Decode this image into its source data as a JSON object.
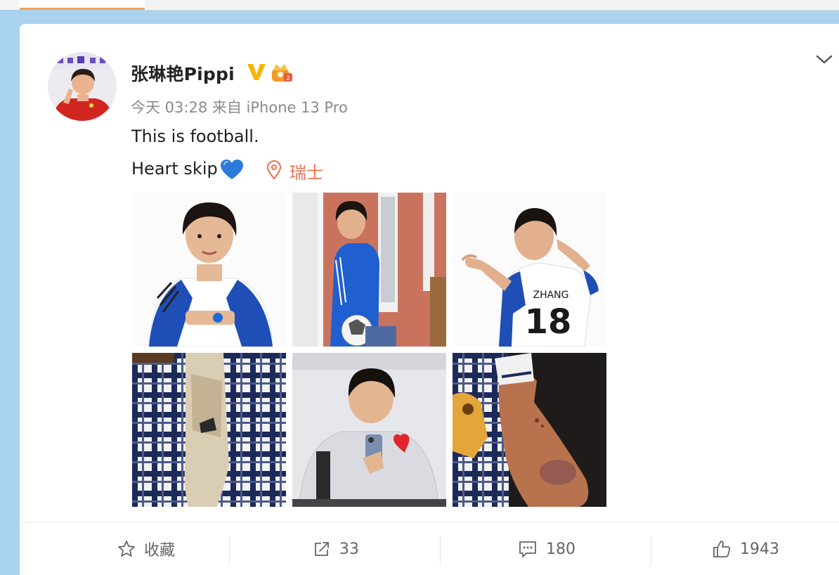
{
  "post": {
    "username": "张琳艳Pippi",
    "meta": "今天 03:28 来自 iPhone 13 Pro",
    "text_line1": "This is football.",
    "text_line2": "Heart skip",
    "location": "瑞士"
  },
  "photos": [
    {
      "icon": "player-front-photo"
    },
    {
      "icon": "player-wall-photo"
    },
    {
      "icon": "player-back-18-photo"
    },
    {
      "icon": "dirty-sock-photo"
    },
    {
      "icon": "mirror-selfie-photo"
    },
    {
      "icon": "bruised-leg-photo"
    }
  ],
  "actions": {
    "favorite_label": "收藏",
    "repost_count": "33",
    "comment_count": "180",
    "like_count": "1943"
  },
  "colors": {
    "accent": "#eb7350",
    "badge_gold": "#f7b500",
    "background": "#a9d3ef"
  }
}
